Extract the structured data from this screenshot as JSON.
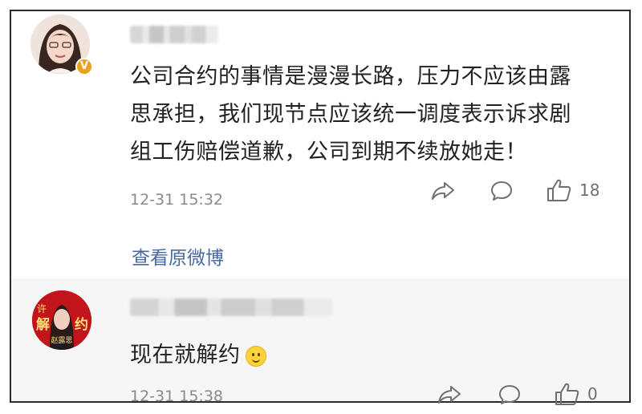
{
  "comment1": {
    "badge": "V",
    "text_lines": [
      "公司合约的事情是漫漫长路，压力不应该由露",
      "思承担，我们现节点应该统一调度表示诉求剧",
      "组工伤赔偿道歉，公司到期不续放她走！"
    ],
    "time": "12-31 15:32",
    "like_count": "18",
    "view_original": "查看原微博"
  },
  "comment2": {
    "avatar_text": {
      "left": "许",
      "big1": "解",
      "big2": "约",
      "bottom": "赵露思"
    },
    "text": "现在就解约",
    "time": "12-31 15:38",
    "like_count": "0"
  },
  "colors": {
    "link": "#46699f",
    "meta": "#8a8a8a",
    "badge": "#e8a21f",
    "avatar2_bg": "#c2141b"
  },
  "icons": [
    "share-icon",
    "comment-icon",
    "like-icon",
    "smile-emoji-icon",
    "verified-badge-icon"
  ]
}
